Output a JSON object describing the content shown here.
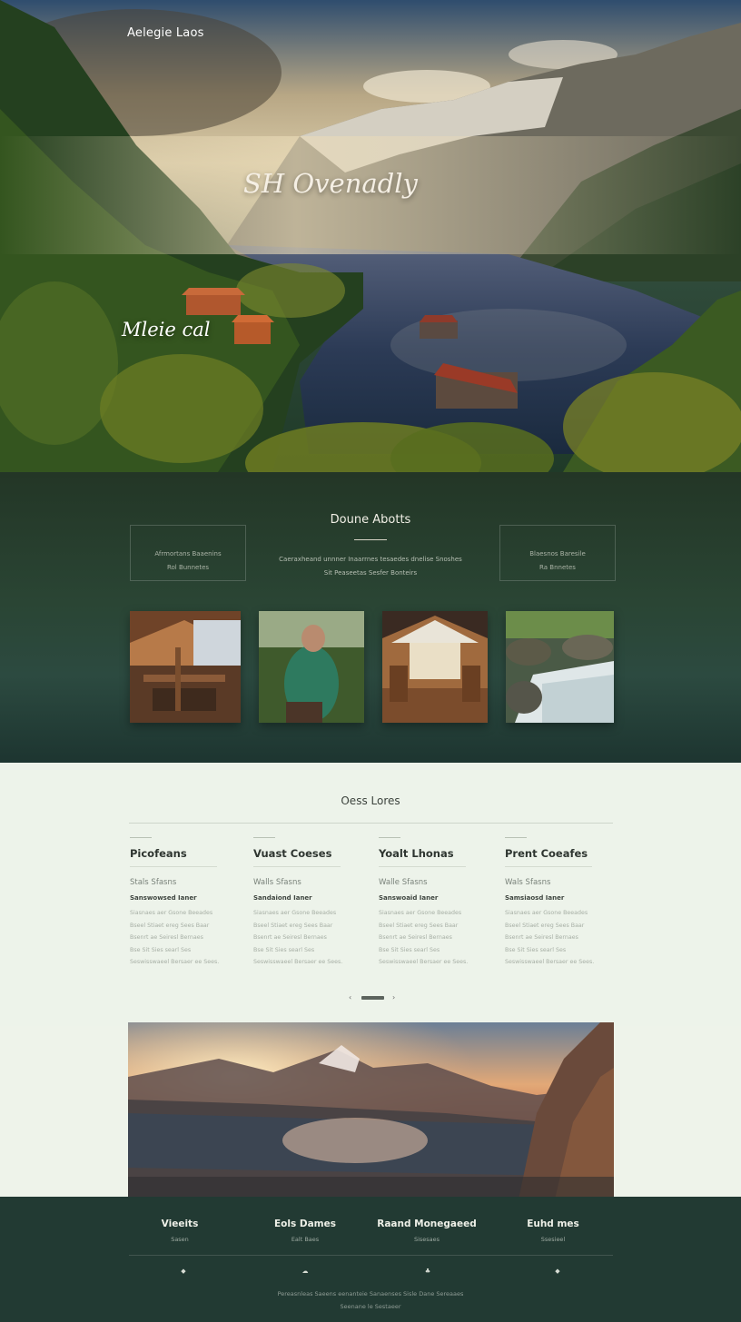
{
  "hero": {
    "brand": "Aelegie Laos",
    "title": "SH Ovenadly",
    "subtitle": "Mleie cal"
  },
  "about": {
    "title": "Doune Abotts",
    "left_box": {
      "line1": "Afrmortans Baaenins",
      "line2": "Rol Bunnetes"
    },
    "right_box": {
      "line1": "Blaesnos Baresile",
      "line2": "Ra Bnnetes"
    },
    "mid_text": {
      "line1": "Caeraxheand unnner Inaarrnes tesaedes dnelise Snoshes",
      "line2": "Sit Peaseetas Sesfer Bonteirs"
    },
    "thumbnails": [
      {
        "name": "cabin-interior",
        "icon": "cabin-photo"
      },
      {
        "name": "hiker",
        "icon": "person-photo"
      },
      {
        "name": "lodge-room",
        "icon": "room-photo"
      },
      {
        "name": "river-rapids",
        "icon": "water-photo"
      }
    ]
  },
  "lores": {
    "title": "Oess Lores",
    "columns": [
      {
        "heading": "Picofeans",
        "sub": "Stals Sfasns",
        "bold": "Sanswowsed Ianer",
        "lines": [
          "Siasnaes aer Gsone Beeades",
          "Bseel Stiaet ereg Sees Baar",
          "Bsenrt ae Seiresl Bernaes",
          "Bse Sit Sies searl Ses",
          "Seswisswaeel Bersaer ee Sees."
        ]
      },
      {
        "heading": "Vuast Coeses",
        "sub": "Walls Sfasns",
        "bold": "Sandaiond Ianer",
        "lines": [
          "Siasnaes aer Gsone Beeades",
          "Bseel Stiaet ereg Sees Baar",
          "Bsenrt ae Seiresl Bernaes",
          "Bse Sit Sies searl Ses",
          "Seswisswaeel Bersaer ee Sees."
        ]
      },
      {
        "heading": "Yoalt Lhonas",
        "sub": "Walle Sfasns",
        "bold": "Sanswoaid Ianer",
        "lines": [
          "Siasnaes aer Gsone Beeades",
          "Bseel Stiaet ereg Sees Baar",
          "Bsenrt ae Seiresl Bernaes",
          "Bse Sit Sies searl Ses",
          "Seswisswaeel Bersaer ee Sees."
        ]
      },
      {
        "heading": "Prent Coeafes",
        "sub": "Wals Sfasns",
        "bold": "Samsiaosd Ianer",
        "lines": [
          "Siasnaes aer Gsone Beeades",
          "Bseel Stiaet ereg Sees Baar",
          "Bsenrt ae Seiresl Bernaes",
          "Bse Sit Sies searl Ses",
          "Seswisswaeel Bersaer ee Sees."
        ]
      }
    ],
    "pager": {
      "prev": "‹",
      "next": "›"
    }
  },
  "bottom": {
    "columns": [
      {
        "heading": "Vieeits",
        "sub": "Sasen",
        "icon": "dot-icon"
      },
      {
        "heading": "Eols Dames",
        "sub": "Ealt Baes",
        "icon": "cloud-icon"
      },
      {
        "heading": "Raand Monegaeed",
        "sub": "Sisesaes",
        "icon": "leaf-icon"
      },
      {
        "heading": "Euhd mes",
        "sub": "Ssesieel",
        "icon": "dot-icon"
      }
    ],
    "footer": {
      "line1": "Pereasnleas Saeens eenanteie Sanaenses Sisle Dane Sereaaes",
      "line2": "Seenane le Sestaeer"
    }
  }
}
